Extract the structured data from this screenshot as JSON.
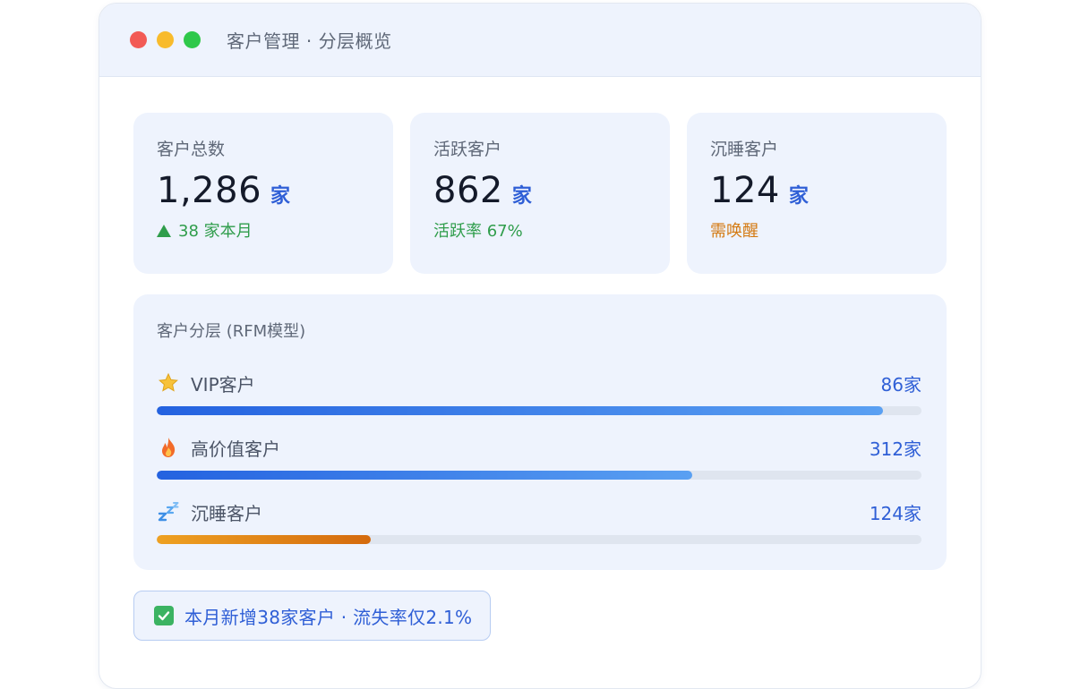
{
  "window": {
    "title": "客户管理 · 分层概览"
  },
  "stats": [
    {
      "label": "客户总数",
      "value": "1,286",
      "unit": "家",
      "sub": "38 家本月",
      "sub_trend": "up",
      "sub_color": "#2f9d4b"
    },
    {
      "label": "活跃客户",
      "value": "862",
      "unit": "家",
      "sub": "活跃率 67%",
      "sub_color": "#2f9d4b"
    },
    {
      "label": "沉睡客户",
      "value": "124",
      "unit": "家",
      "sub": "需唤醒",
      "sub_color": "#d47a12"
    }
  ],
  "segments": {
    "title": "客户分层 (RFM模型)",
    "items": [
      {
        "icon": "star-icon",
        "label": "VIP客户",
        "count": "86家",
        "progress": 0.95,
        "color": "blue"
      },
      {
        "icon": "fire-icon",
        "label": "高价值客户",
        "count": "312家",
        "progress": 0.7,
        "color": "blue"
      },
      {
        "icon": "sleep-icon",
        "label": "沉睡客户",
        "count": "124家",
        "progress": 0.28,
        "color": "orange"
      }
    ]
  },
  "note": {
    "icon": "checkbox-checked-icon",
    "text": "本月新增38家客户 · 流失率仅2.1%"
  },
  "colors": {
    "accent": "#2f5fd6",
    "green": "#2f9d4b",
    "orange": "#d47a12",
    "card_bg": "#eef3fd"
  }
}
